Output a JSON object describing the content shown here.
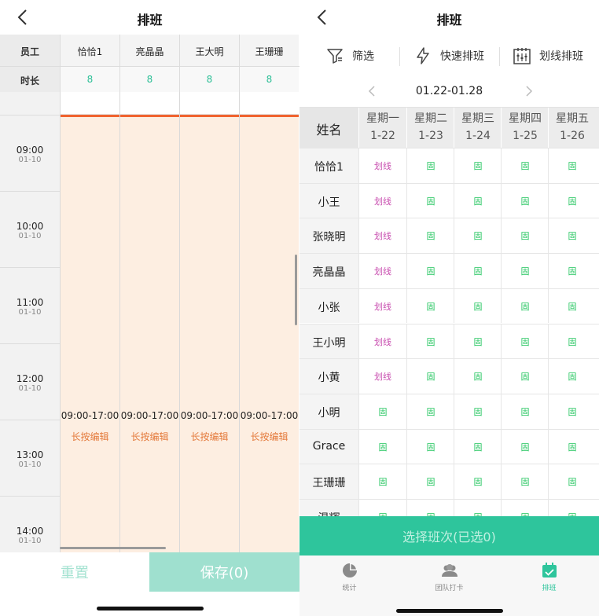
{
  "left": {
    "title": "排班",
    "header": {
      "employee_label": "员工",
      "duration_label": "时长"
    },
    "employees": [
      {
        "name": "恰恰1",
        "duration": "8"
      },
      {
        "name": "亮晶晶",
        "duration": "8"
      },
      {
        "name": "王大明",
        "duration": "8"
      },
      {
        "name": "王珊珊",
        "duration": "8"
      }
    ],
    "times": [
      {
        "time": "09:00",
        "date": "01-10"
      },
      {
        "time": "10:00",
        "date": "01-10"
      },
      {
        "time": "11:00",
        "date": "01-10"
      },
      {
        "time": "12:00",
        "date": "01-10"
      },
      {
        "time": "13:00",
        "date": "01-10"
      },
      {
        "time": "14:00",
        "date": "01-10"
      }
    ],
    "shift": {
      "range": "09:00-17:00",
      "hint": "长按编辑"
    },
    "footer": {
      "reset_label": "重置",
      "save_label": "保存(0)"
    }
  },
  "right": {
    "title": "排班",
    "toolbar": {
      "filter_label": "筛选",
      "quick_label": "快速排班",
      "line_label": "划线排班"
    },
    "week_range": "01.22-01.28",
    "name_header": "姓名",
    "days": [
      {
        "weekday": "星期一",
        "date": "1-22"
      },
      {
        "weekday": "星期二",
        "date": "1-23"
      },
      {
        "weekday": "星期三",
        "date": "1-24"
      },
      {
        "weekday": "星期四",
        "date": "1-25"
      },
      {
        "weekday": "星期五",
        "date": "1-26"
      }
    ],
    "rows": [
      {
        "name": "恰恰1",
        "cells": [
          "划线",
          "固",
          "固",
          "固",
          "固"
        ]
      },
      {
        "name": "小王",
        "cells": [
          "划线",
          "固",
          "固",
          "固",
          "固"
        ]
      },
      {
        "name": "张晓明",
        "cells": [
          "划线",
          "固",
          "固",
          "固",
          "固"
        ]
      },
      {
        "name": "亮晶晶",
        "cells": [
          "划线",
          "固",
          "固",
          "固",
          "固"
        ]
      },
      {
        "name": "小张",
        "cells": [
          "划线",
          "固",
          "固",
          "固",
          "固"
        ]
      },
      {
        "name": "王小明",
        "cells": [
          "划线",
          "固",
          "固",
          "固",
          "固"
        ]
      },
      {
        "name": "小黄",
        "cells": [
          "划线",
          "固",
          "固",
          "固",
          "固"
        ]
      },
      {
        "name": "小明",
        "cells": [
          "固",
          "固",
          "固",
          "固",
          "固"
        ]
      },
      {
        "name": "Grace",
        "cells": [
          "固",
          "固",
          "固",
          "固",
          "固"
        ]
      },
      {
        "name": "王珊珊",
        "cells": [
          "固",
          "固",
          "固",
          "固",
          "固"
        ]
      },
      {
        "name": "温辉",
        "cells": [
          "固",
          "固",
          "固",
          "固",
          "固"
        ]
      }
    ],
    "select_button": "选择班次(已选0)",
    "tabs": [
      {
        "label": "统计",
        "icon": "pie-chart-icon"
      },
      {
        "label": "团队打卡",
        "icon": "team-icon"
      },
      {
        "label": "排班",
        "icon": "calendar-check-icon"
      }
    ],
    "colors": {
      "accent": "#2ec59c",
      "line_mark": "#c94fb0",
      "fixed_mark": "#21c55d",
      "shift_bg": "#fdeee1",
      "now_line": "#f0632f"
    }
  }
}
